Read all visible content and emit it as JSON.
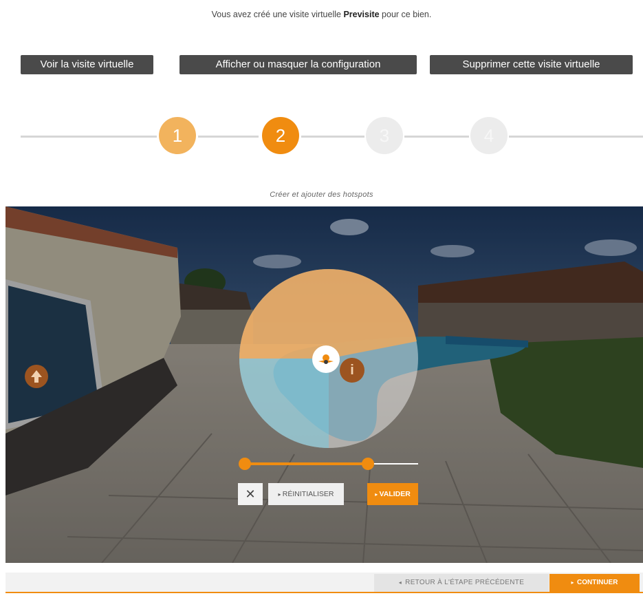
{
  "intro": {
    "prefix": "Vous avez créé une visite virtuelle",
    "brand": "Previsite",
    "suffix": "pour ce bien."
  },
  "actions": {
    "view_label": "Voir la visite virtuelle",
    "toggle_config_label": "Afficher ou masquer la configuration",
    "delete_label": "Supprimer cette visite virtuelle"
  },
  "steps": [
    {
      "number": "1",
      "state": "done"
    },
    {
      "number": "2",
      "state": "active"
    },
    {
      "number": "3",
      "state": "todo"
    },
    {
      "number": "4",
      "state": "todo"
    }
  ],
  "step_caption": "Créer et ajouter des hotspots",
  "panorama": {
    "hotspot_up_icon": "arrow-up-icon",
    "hotspot_info_icon": "info-icon",
    "hotspot_info_glyph": "i",
    "radar_center_icon": "viewpoint-icon"
  },
  "slider": {
    "handle_1": 0,
    "handle_2": 0.71
  },
  "controls": {
    "close_glyph": "✕",
    "reset_label": "RÉINITIALISER",
    "validate_label": "VALIDER"
  },
  "footer": {
    "prev_label": "RETOUR À L'ÉTAPE PRÉCÉDENTE",
    "next_label": "CONTINUER"
  },
  "colors": {
    "accent": "#f08c10",
    "accent_light": "#f2b35d",
    "dark_button": "#4a4a4a"
  }
}
